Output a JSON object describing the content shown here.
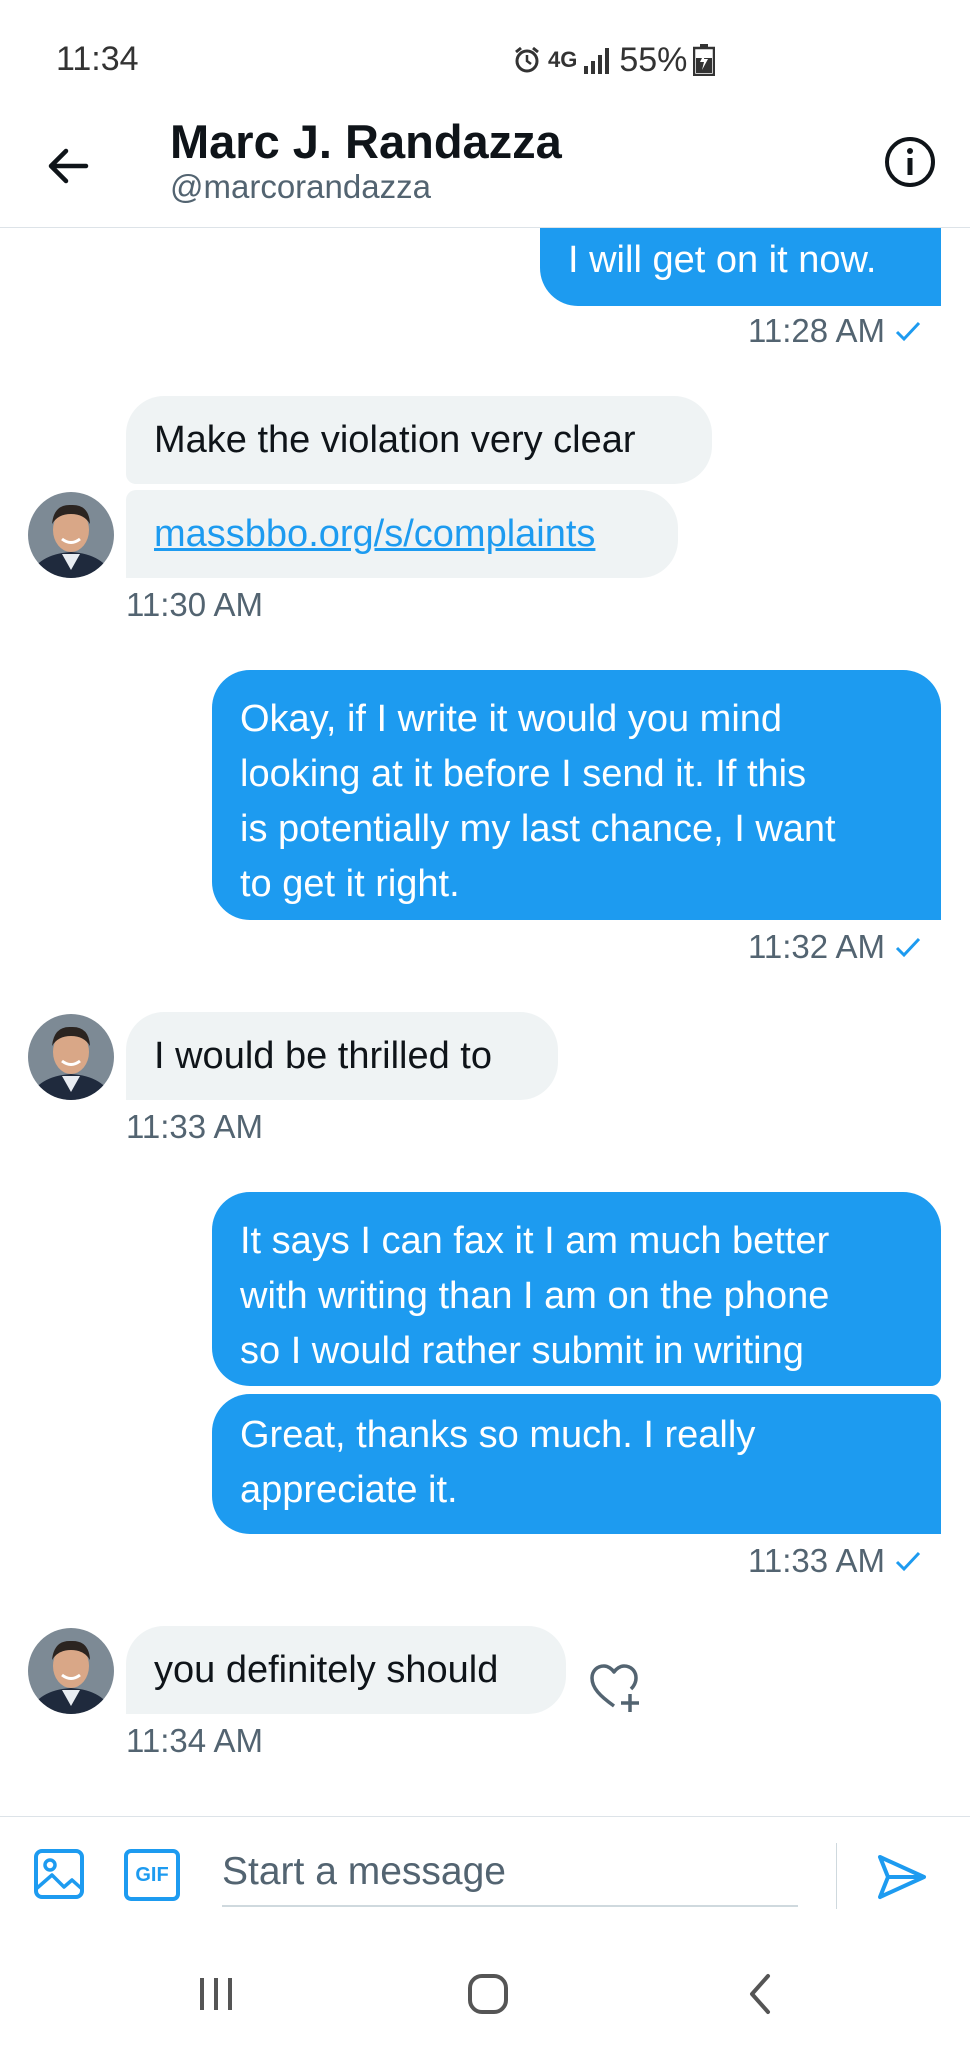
{
  "status_bar": {
    "time": "11:34",
    "network": "4G",
    "battery": "55%"
  },
  "header": {
    "name": "Marc J. Randazza",
    "handle": "@marcorandazza"
  },
  "messages": [
    {
      "direction": "sent",
      "text": "I will get on it now.",
      "time": "11:28 AM"
    },
    {
      "direction": "received",
      "text": "Make the violation very clear"
    },
    {
      "direction": "received",
      "text": "massbbo.org/s/complaints",
      "is_link": true,
      "time": "11:30 AM"
    },
    {
      "direction": "sent",
      "lines": [
        "Okay, if I write it would you mind",
        "looking at it before I send it. If this",
        "is potentially my last chance, I want",
        "to get it right."
      ],
      "time": "11:32 AM"
    },
    {
      "direction": "received",
      "text": "I would be thrilled to",
      "time": "11:33 AM"
    },
    {
      "direction": "sent",
      "lines": [
        "It says I can fax it I am much better",
        "with writing than I am on the phone",
        "so I would rather submit in writing"
      ]
    },
    {
      "direction": "sent",
      "lines": [
        "Great, thanks so much. I really",
        "appreciate it."
      ],
      "time": "11:33 AM"
    },
    {
      "direction": "received",
      "text": "you definitely should",
      "time": "11:34 AM"
    }
  ],
  "composer": {
    "placeholder": "Start a message",
    "gif_label": "GIF"
  },
  "colors": {
    "accent": "#1d9bf0",
    "received_bubble": "#eff3f4",
    "secondary_text": "#536471"
  }
}
